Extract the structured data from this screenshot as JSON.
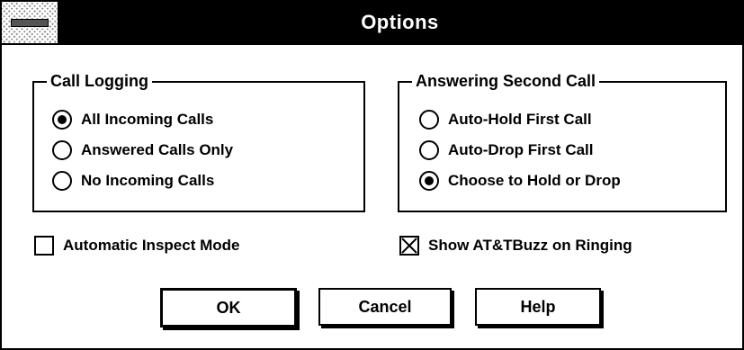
{
  "window": {
    "title": "Options"
  },
  "call_logging": {
    "label": "Call Logging",
    "options": [
      {
        "label": "All Incoming Calls",
        "selected": true
      },
      {
        "label": "Answered Calls Only",
        "selected": false
      },
      {
        "label": "No Incoming Calls",
        "selected": false
      }
    ]
  },
  "answering_second_call": {
    "label": "Answering Second Call",
    "options": [
      {
        "label": "Auto-Hold First Call",
        "selected": false
      },
      {
        "label": "Auto-Drop First Call",
        "selected": false
      },
      {
        "label": "Choose to Hold or Drop",
        "selected": true
      }
    ]
  },
  "checkboxes": {
    "automatic_inspect_mode": {
      "label": "Automatic Inspect Mode",
      "checked": false
    },
    "show_attbuzz": {
      "label": "Show AT&TBuzz on Ringing",
      "checked": true
    }
  },
  "buttons": {
    "ok": "OK",
    "cancel": "Cancel",
    "help": "Help"
  }
}
